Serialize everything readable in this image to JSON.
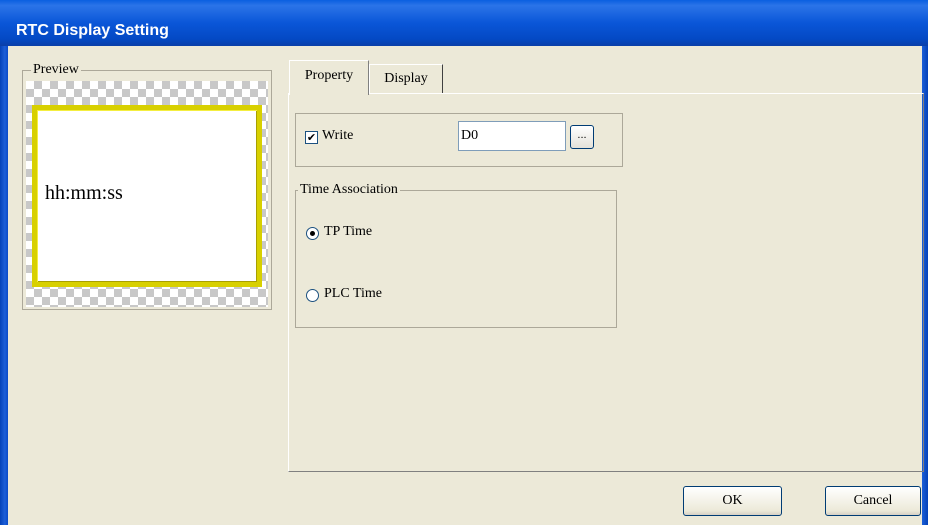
{
  "window": {
    "title": "RTC Display Setting"
  },
  "preview": {
    "label": "Preview",
    "display_text": "hh:mm:ss"
  },
  "tabs": [
    {
      "label": "Property",
      "active": true
    },
    {
      "label": "Display",
      "active": false
    }
  ],
  "property": {
    "write": {
      "label": "Write",
      "checked": true,
      "address": "D0",
      "browse_label": "..."
    },
    "time_association": {
      "label": "Time Association",
      "options": [
        {
          "label": "TP Time",
          "selected": true
        },
        {
          "label": "PLC Time",
          "selected": false
        }
      ]
    }
  },
  "buttons": {
    "ok": "OK",
    "cancel": "Cancel"
  },
  "colors": {
    "titlebar": "#0a56d8",
    "dialog_bg": "#ece9d8",
    "preview_frame": "#d8d000"
  }
}
